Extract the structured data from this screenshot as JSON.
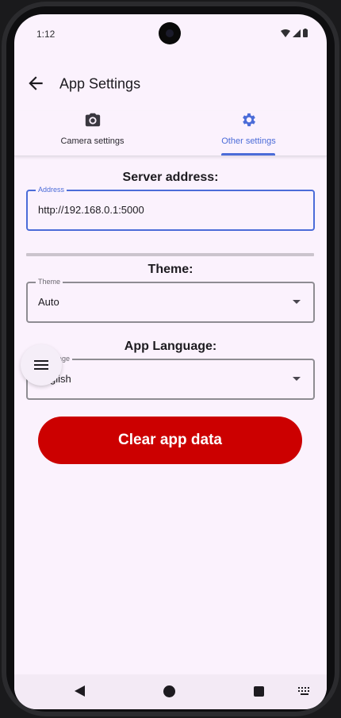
{
  "status_bar": {
    "time": "1:12"
  },
  "app_bar": {
    "title": "App Settings"
  },
  "tabs": [
    {
      "label": "Camera settings",
      "icon": "camera-icon",
      "selected": false
    },
    {
      "label": "Other settings",
      "icon": "gear-icon",
      "selected": true
    }
  ],
  "server": {
    "section_title": "Server address:",
    "field_label": "Address",
    "field_value": "http://192.168.0.1:5000"
  },
  "theme": {
    "section_title": "Theme:",
    "field_label": "Theme",
    "selected": "Auto"
  },
  "language": {
    "section_title": "App Language:",
    "field_label_visible": "uage",
    "selected_visible": "glish"
  },
  "actions": {
    "clear_label": "Clear app data"
  },
  "colors": {
    "accent": "#4b6cd8",
    "danger": "#cc0000",
    "background": "#fbf2fd"
  }
}
